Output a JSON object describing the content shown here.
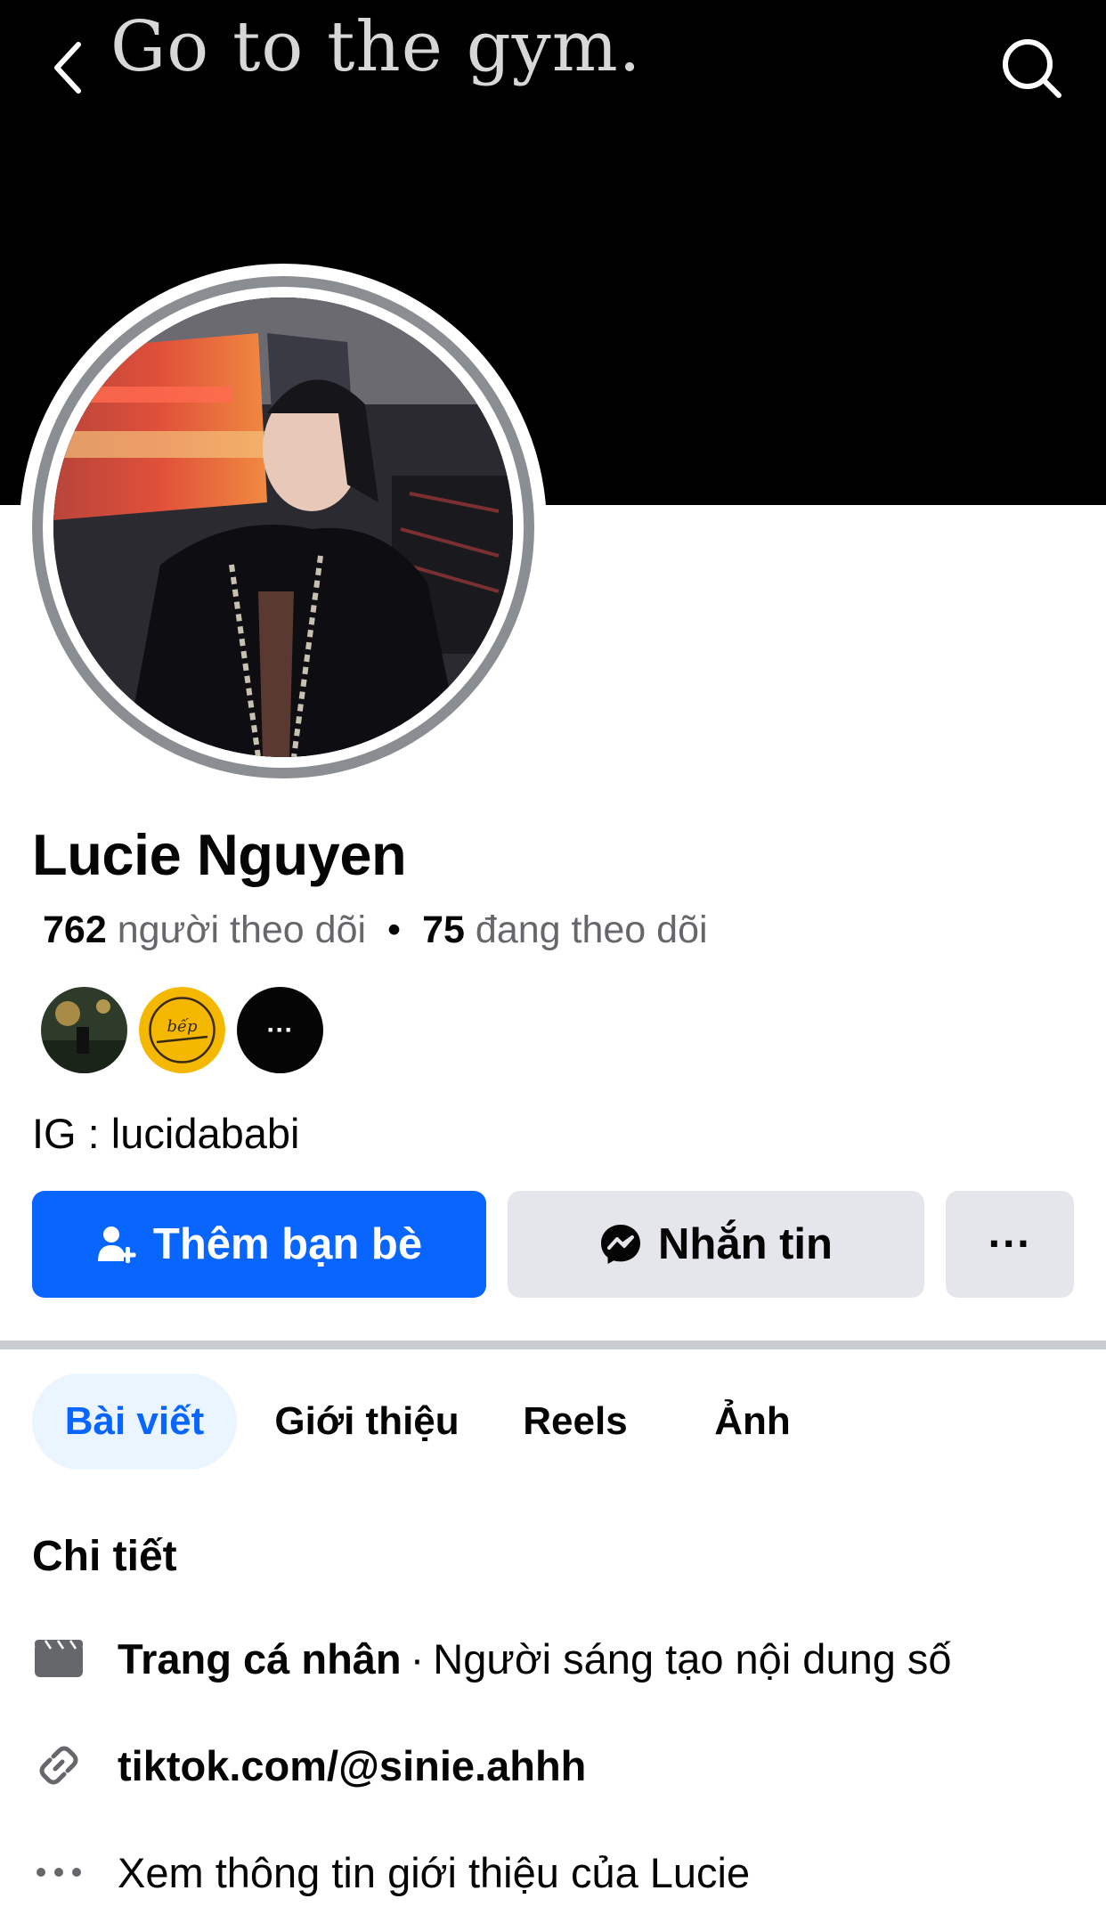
{
  "cover": {
    "text": "Go to the gym."
  },
  "header": {
    "back_icon": "chevron-left-icon",
    "search_icon": "search-icon"
  },
  "profile": {
    "name": "Lucie Nguyen",
    "followers_count": "762",
    "followers_label": "người theo dõi",
    "dot": "•",
    "following_count": "75",
    "following_label": "đang theo dõi",
    "bio": "IG : lucidababi"
  },
  "mutuals": {
    "more_label": "···",
    "badge_text": "bếp"
  },
  "actions": {
    "add_friend": "Thêm bạn bè",
    "message": "Nhắn tin",
    "more": "···"
  },
  "tabs": [
    {
      "label": "Bài viết",
      "active": true
    },
    {
      "label": "Giới thiệu",
      "active": false
    },
    {
      "label": "Reels",
      "active": false
    },
    {
      "label": "Ảnh",
      "active": false
    }
  ],
  "details": {
    "title": "Chi tiết",
    "page_type_bold": "Trang cá nhân",
    "page_type_sep": "·",
    "page_type_text": "Người sáng tạo nội dung số",
    "link": "tiktok.com/@sinie.ahhh",
    "see_more": "Xem thông tin giới thiệu của Lucie"
  },
  "colors": {
    "primary": "#0866ff",
    "secondary_button": "#e4e6eb",
    "muted_text": "#65676b",
    "cover": "#000000"
  }
}
